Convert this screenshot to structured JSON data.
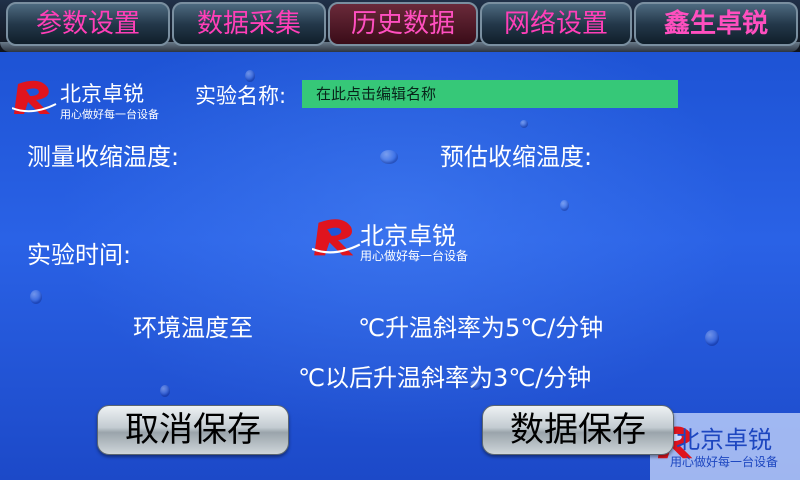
{
  "tabs": [
    {
      "label": "参数设置"
    },
    {
      "label": "数据采集"
    },
    {
      "label": "历史数据"
    },
    {
      "label": "网络设置"
    },
    {
      "label": "鑫生卓锐"
    }
  ],
  "logo": {
    "name": "北京卓锐",
    "slogan": "用心做好每一台设备"
  },
  "experiment": {
    "name_label": "实验名称:",
    "name_value": "在此点击编辑名称",
    "measured_label": "测量收缩温度:",
    "estimated_label": "预估收缩温度:",
    "time_label": "实验时间:"
  },
  "program": {
    "line1_prefix": "环境温度至",
    "line1_suffix": "℃升温斜率为5℃/分钟",
    "line2": "℃以后升温斜率为3℃/分钟"
  },
  "buttons": {
    "cancel": "取消保存",
    "save": "数据保存"
  },
  "colors": {
    "background": "#1f55d8",
    "tab_text": "#ff3fb8",
    "input_bg": "#36c878",
    "logo_red": "#e0141e"
  }
}
